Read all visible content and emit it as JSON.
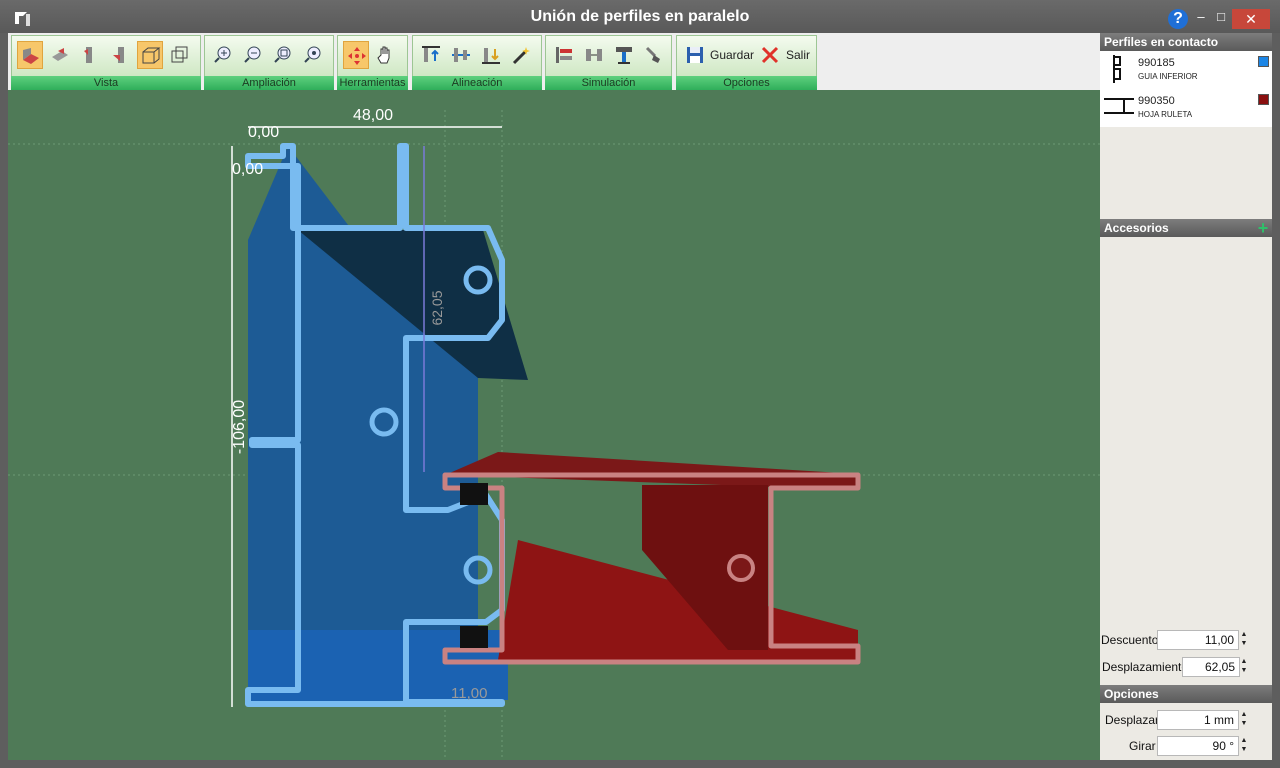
{
  "window": {
    "title": "Unión de perfiles en paralelo",
    "help_label": "?",
    "minimize_label": "–",
    "maximize_label": "□",
    "close_label": "✕"
  },
  "toolbar": {
    "groups": [
      {
        "name": "Vista",
        "buttons": [
          "view-front-icon",
          "view-side-icon",
          "view-left-icon",
          "view-right-icon",
          "view-perspective-icon",
          "view-box-icon"
        ]
      },
      {
        "name": "Ampliación",
        "buttons": [
          "zoom-in-icon",
          "zoom-out-icon",
          "zoom-fit-icon",
          "zoom-all-icon"
        ]
      },
      {
        "name": "Herramientas",
        "buttons": [
          "move-icon",
          "pan-hand-icon"
        ]
      },
      {
        "name": "Alineación",
        "buttons": [
          "align-top-icon",
          "align-middle-icon",
          "align-bottom-icon",
          "magic-wand-icon"
        ]
      },
      {
        "name": "Simulación",
        "buttons": [
          "sim-profiles-icon",
          "sim-gap-icon",
          "sim-tool-icon",
          "sim-brush-icon"
        ]
      },
      {
        "name": "Opciones",
        "buttons": [
          "save-icon",
          "exit-icon"
        ]
      }
    ],
    "save_label": "Guardar",
    "exit_label": "Salir"
  },
  "canvas": {
    "dim_top_width": "48,00",
    "dim_origin_x": "0,00",
    "dim_origin_y": "0,00",
    "dim_height": "-106,00",
    "dim_offset": "62,05",
    "dim_discount": "11,00",
    "colors": {
      "background": "#4f7a57",
      "profile_blue": "#6fb3ec",
      "profile_red": "#c98282"
    }
  },
  "panel": {
    "contact_title": "Perfiles en contacto",
    "profiles": [
      {
        "code": "990185",
        "name": "GUIA INFERIOR",
        "color": "#1c86e6"
      },
      {
        "code": "990350",
        "name": "HOJA RULETA",
        "color": "#8a1010"
      }
    ],
    "accessories_title": "Accesorios",
    "add_label": "+",
    "descuento_label": "Descuento",
    "descuento_value": "11,00",
    "desplazamiento_label": "Desplazamiento",
    "desplazamiento_value": "62,05",
    "options_title": "Opciones",
    "desplazar_label": "Desplazar",
    "desplazar_value": "1 mm",
    "girar_label": "Girar",
    "girar_value": "90 °"
  }
}
